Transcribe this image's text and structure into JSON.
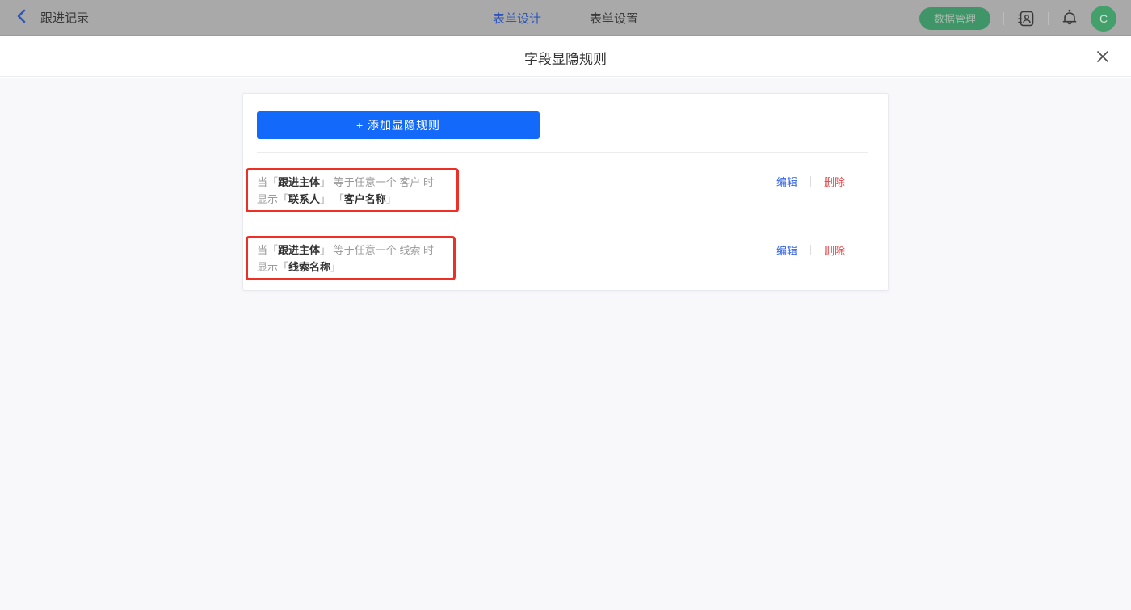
{
  "header": {
    "back": {
      "label": "跟进记录"
    },
    "tabs": [
      {
        "label": "表单设计",
        "active": true
      },
      {
        "label": "表单设置",
        "active": false
      }
    ],
    "actions": {
      "data_manage_label": "数据管理",
      "avatar_text": "C"
    },
    "icons": {
      "back": "chevron-left",
      "contacts": "address-book",
      "notifications": "bell"
    }
  },
  "modal": {
    "title": "字段显隐规则",
    "close_icon": "x",
    "add_button_label": "+ 添加显隐规则"
  },
  "punct": {
    "open": "「",
    "close": "」"
  },
  "rules": [
    {
      "when": "当",
      "field": "跟进主体",
      "operator": "等于任意一个",
      "value": "客户",
      "then": "时",
      "show": "显示",
      "targets": [
        "联系人",
        "客户名称"
      ],
      "edit": "编辑",
      "delete": "删除"
    },
    {
      "when": "当",
      "field": "跟进主体",
      "operator": "等于任意一个",
      "value": "线索",
      "then": "时",
      "show": "显示",
      "targets": [
        "线索名称"
      ],
      "edit": "编辑",
      "delete": "删除"
    }
  ],
  "colors": {
    "primary_blue": "#1269fa",
    "link_blue": "#3464e5",
    "danger_red": "#e84749",
    "rule_highlight_border": "#ee2f25",
    "header_pill_green": "#3f9468",
    "avatar_green": "#44a06b",
    "dimmed_header_bg": "#a9a9a9",
    "modal_body_bg": "#f8f8fa"
  }
}
